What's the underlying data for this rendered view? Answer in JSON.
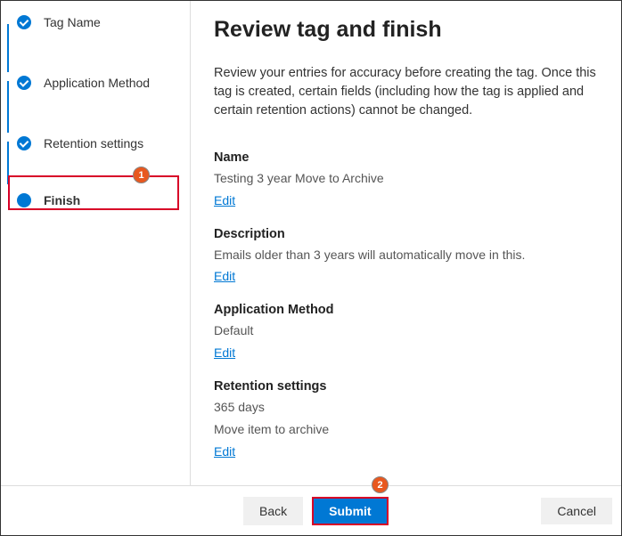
{
  "sidebar": {
    "steps": [
      {
        "label": "Tag Name",
        "state": "completed"
      },
      {
        "label": "Application Method",
        "state": "completed"
      },
      {
        "label": "Retention settings",
        "state": "completed"
      },
      {
        "label": "Finish",
        "state": "current"
      }
    ]
  },
  "callouts": {
    "one": "1",
    "two": "2"
  },
  "main": {
    "title": "Review tag and finish",
    "intro": "Review your entries for accuracy before creating the tag. Once this tag is created, certain fields (including how the tag is applied and certain retention actions) cannot be changed.",
    "sections": {
      "name": {
        "label": "Name",
        "value": "Testing 3 year Move to Archive",
        "edit": "Edit"
      },
      "description": {
        "label": "Description",
        "value": "Emails older than 3 years will automatically move in this.",
        "edit": "Edit"
      },
      "applicationMethod": {
        "label": "Application Method",
        "value": "Default",
        "edit": "Edit"
      },
      "retentionSettings": {
        "label": "Retention settings",
        "value1": "365 days",
        "value2": "Move item to archive",
        "edit": "Edit"
      }
    }
  },
  "footer": {
    "back": "Back",
    "submit": "Submit",
    "cancel": "Cancel"
  }
}
